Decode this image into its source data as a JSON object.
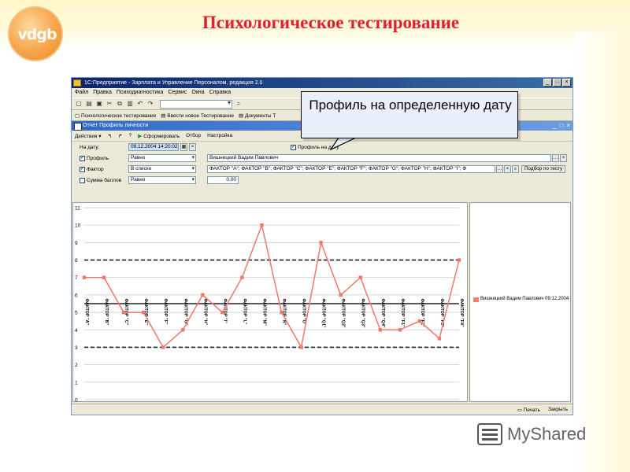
{
  "slide": {
    "title": "Психологическое тестирование",
    "logo_text": "vdgb",
    "callout": "Профиль на определенную дату",
    "brand": "MyShared"
  },
  "window": {
    "title": "1С:Предприятие - Зарплата и Управление Персоналом, редакция 2.0",
    "menu": [
      "Файл",
      "Правка",
      "Психодиагностика",
      "Сервис",
      "Окна",
      "Справка"
    ],
    "taskbar": [
      "Психологическое тестирование",
      "Ввести новое Тестирование",
      "Документы Т"
    ],
    "doc_title": "Отчет  Профиль личности",
    "actions": [
      "Действия",
      "Сформировать",
      "Отбор",
      "Настройка"
    ],
    "controls": [
      "▾",
      "↰",
      "↱",
      "?"
    ],
    "toolbar_icons": [
      "new-icon",
      "open-icon",
      "save-icon",
      "cut-icon",
      "copy-icon",
      "paste-icon",
      "undo-icon",
      "redo-icon"
    ]
  },
  "form": {
    "date_label": "На дату:",
    "date_value": "09.12.2004 14:20:02",
    "profile_checkbox": "Профиль на дату",
    "rows": [
      {
        "label": "Профиль",
        "checked": true,
        "condition": "Равно",
        "value": "Вишницкий Вадим Павлович"
      },
      {
        "label": "Фактор",
        "checked": true,
        "condition": "В списке",
        "value": "ФАКТОР \"A\"; ФАКТОР \"B\"; ФАКТОР \"C\"; ФАКТОР \"E\"; ФАКТОР \"F\"; ФАКТОР \"G\"; ФАКТОР \"H\"; ФАКТОР \"I\"; Ф"
      },
      {
        "label": "Сумма баллов",
        "checked": false,
        "condition": "Равно",
        "value": "0,00"
      }
    ],
    "select_button": "Подбор по тесту"
  },
  "status": {
    "print": "Печать",
    "close": "Закрыть"
  },
  "chart_data": {
    "type": "line",
    "categories": [
      "ФАКТОР \"A\"",
      "ФАКТОР \"B\"",
      "ФАКТОР \"C\"",
      "ФАКТОР \"E\"",
      "ФАКТОР \"F\"",
      "ФАКТОР \"G\"",
      "ФАКТОР \"H\"",
      "ФАКТОР \"I\"",
      "ФАКТОР \"L\"",
      "ФАКТОР \"M\"",
      "ФАКТОР \"N\"",
      "ФАКТОР \"O\"",
      "ФАКТОР \"Q1\"",
      "ФАКТОР \"Q2\"",
      "ФАКТОР \"Q3\"",
      "ФАКТОР \"Q4\"",
      "ФАКТОР \"F1\"",
      "ФАКТОР \"F2\"",
      "ФАКТОР \"F3\"",
      "ФАКТОР \"F4\""
    ],
    "series": [
      {
        "name": "Вишницкий Вадим Павлович 09.12.2004",
        "values": [
          7,
          7,
          5,
          5,
          3,
          4,
          6,
          5,
          7,
          10,
          5,
          3,
          9,
          6,
          7,
          4,
          4,
          4.5,
          3.5,
          8
        ]
      }
    ],
    "yticks": [
      0,
      1,
      2,
      3,
      4,
      5,
      6,
      7,
      8,
      9,
      10,
      11
    ],
    "ylim": [
      0,
      11
    ],
    "dashed_lines": [
      3,
      8
    ],
    "solid_line": 5.5,
    "grid": true,
    "legend": "right",
    "series_color": "#f07868"
  }
}
